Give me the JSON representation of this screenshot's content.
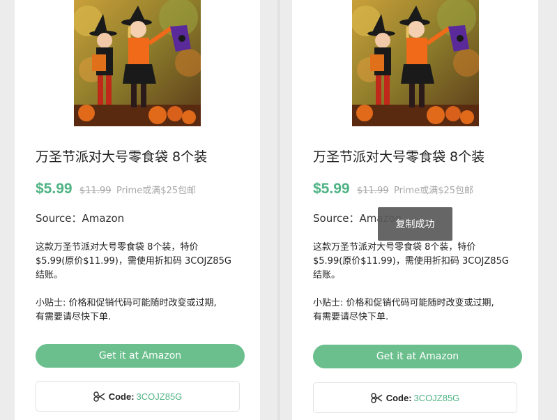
{
  "cards": [
    {
      "title": "万圣节派对大号零食袋 8个装",
      "price": "$5.99",
      "original_price": "$11.99",
      "shipping": "Prime或满$25包邮",
      "source": "Source：Amazon",
      "description_lines": [
        "这款万圣节派对大号零食袋 8个装，特价",
        "$5.99(原价$11.99)，需使用折扣码 3COJZ85G",
        "结账。"
      ],
      "tip_lines": [
        "小贴士: 价格和促销代码可能随时改变或过期,",
        "有需要请尽快下单."
      ],
      "button_label": "Get it at Amazon",
      "code_label": "Code:",
      "code_value": "3COJZ85G",
      "icons": {
        "scissors": "scissors-icon"
      }
    },
    {
      "title": "万圣节派对大号零食袋 8个装",
      "price": "$5.99",
      "original_price": "$11.99",
      "shipping": "Prime或满$25包邮",
      "source": "Source：Amazon",
      "description_lines": [
        "这款万圣节派对大号零食袋 8个装，特价",
        "$5.99(原价$11.99)，需使用折扣码 3COJZ85G",
        "结账。"
      ],
      "tip_lines": [
        "小贴士: 价格和促销代码可能随时改变或过期,",
        "有需要请尽快下单."
      ],
      "button_label": "Get it at Amazon",
      "code_label": "Code:",
      "code_value": "3COJZ85G",
      "icons": {
        "scissors": "scissors-icon"
      }
    }
  ],
  "toast": {
    "message": "复制成功"
  },
  "colors": {
    "accent": "#4fb384",
    "button": "#6abf8d",
    "background": "#e9e9e9",
    "toast": "#5a5a5a"
  }
}
